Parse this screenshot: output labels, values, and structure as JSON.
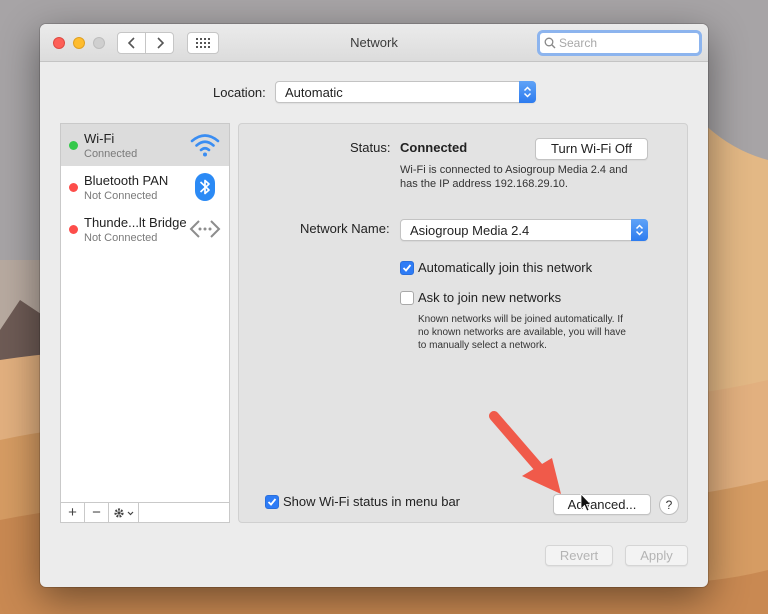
{
  "window": {
    "title": "Network",
    "search": {
      "placeholder": "Search",
      "value": ""
    }
  },
  "location": {
    "label": "Location:",
    "value": "Automatic"
  },
  "services": [
    {
      "name": "Wi-Fi",
      "status": "Connected",
      "status_color": "#34c84a",
      "icon": "wifi-icon"
    },
    {
      "name": "Bluetooth PAN",
      "status": "Not Connected",
      "status_color": "#fd4d4a",
      "icon": "bluetooth-icon"
    },
    {
      "name": "Thunde...lt Bridge",
      "status": "Not Connected",
      "status_color": "#fd4d4a",
      "icon": "thunderbolt-bridge-icon"
    }
  ],
  "sidebar_footer": {
    "add": "+",
    "remove": "−",
    "gear": "gear-icon"
  },
  "detail": {
    "status_label": "Status:",
    "status_value": "Connected",
    "turn_off_button": "Turn Wi-Fi Off",
    "status_desc_line1": "Wi-Fi is connected to Asiogroup Media 2.4 and",
    "status_desc_line2": "has the IP address 192.168.29.10.",
    "network_name_label": "Network Name:",
    "network_name_value": "Asiogroup Media 2.4",
    "auto_join": {
      "label": "Automatically join this network",
      "checked": true
    },
    "ask_join": {
      "label": "Ask to join new networks",
      "checked": false
    },
    "ask_desc_line1": "Known networks will be joined automatically. If",
    "ask_desc_line2": "no known networks are available, you will have",
    "ask_desc_line3": "to manually select a network.",
    "show_status": {
      "label": "Show Wi-Fi status in menu bar",
      "checked": true
    },
    "advanced_button": "Advanced...",
    "help_button": "?"
  },
  "footer": {
    "revert": "Revert",
    "apply": "Apply"
  },
  "colors": {
    "accent": "#2e7cf6",
    "arrow": "#f05a4a"
  }
}
